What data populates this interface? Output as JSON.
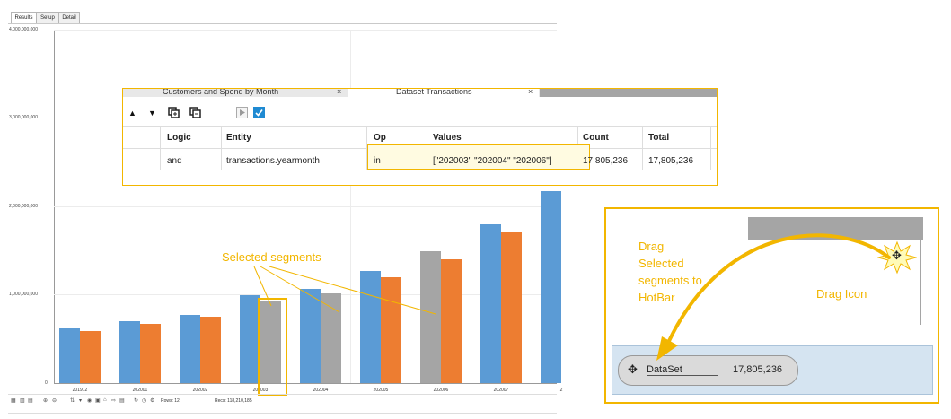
{
  "tabs": [
    "Results",
    "Setup",
    "Detail"
  ],
  "chart_data": {
    "type": "bar",
    "categories": [
      "201912",
      "202001",
      "202002",
      "202003",
      "202004",
      "202005",
      "202006",
      "202007",
      "2"
    ],
    "series": [
      {
        "values": [
          620000000,
          700000000,
          770000000,
          1000000000,
          1070000000,
          1270000000,
          1490000000,
          1800000000,
          2170000000
        ]
      },
      {
        "values": [
          590000000,
          670000000,
          750000000,
          920000000,
          1020000000,
          1200000000,
          1400000000,
          1710000000,
          null
        ]
      }
    ],
    "y_ticks": [
      "4,000,000,000",
      "3,000,000,000",
      "2,000,000,000",
      "1,000,000,000",
      "0"
    ],
    "ylim": [
      0,
      4000000000
    ],
    "selected_categories": [
      "202003",
      "202004",
      "202006"
    ],
    "colors": {
      "series1": "#5b9bd5",
      "series2": "#ed7d31",
      "selected": "#a5a5a5"
    },
    "grid": true
  },
  "popup": {
    "tab1": "Customers and Spend by Month",
    "tab2": "Dataset Transactions",
    "columns": [
      "Logic",
      "Entity",
      "Op",
      "Values",
      "Count",
      "Total"
    ],
    "row": {
      "logic": "and",
      "entity": "transactions.yearmonth",
      "op": "in",
      "values": "[\"202003\" \"202004\" \"202006\"]",
      "count": "17,805,236",
      "total": "17,805,236"
    }
  },
  "callouts": {
    "selected_segments": "Selected segments",
    "drag_text": "Drag\nSelected\nsegments to\nHotBar",
    "drag_icon": "Drag Icon"
  },
  "hotbar": {
    "dataset_label": "DataSet",
    "dataset_count": "17,805,236"
  },
  "statusbar": {
    "rows": "Rows: 12",
    "recs": "Recs: 118,210,185"
  },
  "colors": {
    "accent": "#f2b600",
    "hotbar_bg": "#d5e4f1"
  }
}
